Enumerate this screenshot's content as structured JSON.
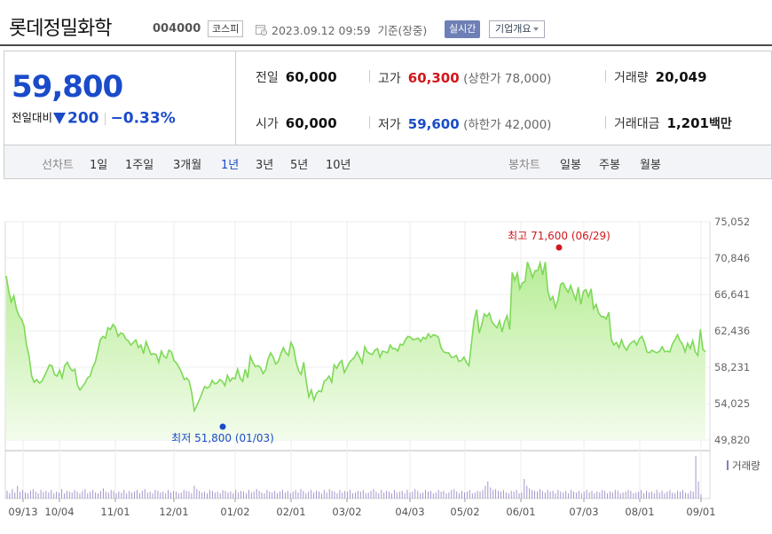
{
  "header": {
    "company_name": "롯데정밀화학",
    "stock_code": "004000",
    "market": "코스피",
    "timestamp": "2023.09.12 09:59",
    "basis": "기준(장중)",
    "realtime_label": "실시간",
    "overview_label": "기업개요"
  },
  "price": {
    "current": "59,800",
    "change_label": "전일대비",
    "change_value": "200",
    "change_percent": "−0.33%"
  },
  "info": {
    "prev_close_label": "전일",
    "prev_close": "60,000",
    "high_label": "고가",
    "high": "60,300",
    "upper_limit": "(상한가 78,000)",
    "volume_label": "거래량",
    "volume": "20,049",
    "open_label": "시가",
    "open": "60,000",
    "low_label": "저가",
    "low": "59,600",
    "lower_limit": "(하한가 42,000)",
    "amount_label": "거래대금",
    "amount": "1,201",
    "amount_unit": "백만"
  },
  "period_bar": {
    "line_label": "선차트",
    "line_options": [
      "1일",
      "1주일",
      "3개월",
      "1년",
      "3년",
      "5년",
      "10년"
    ],
    "line_active": "1년",
    "candle_label": "봉차트",
    "candle_options": [
      "일봉",
      "주봉",
      "월봉"
    ]
  },
  "colors": {
    "up": "#d1171d",
    "down": "#1a4bc9",
    "area_line": "#7ed957",
    "area_fill": "#c9f0b4"
  },
  "chart_data": {
    "type": "area",
    "y_ticks": [
      "75,052",
      "70,846",
      "66,641",
      "62,436",
      "58,231",
      "54,025",
      "49,820"
    ],
    "ylim": [
      49820,
      75052
    ],
    "x_ticks": [
      "09/13",
      "10/04",
      "11/01",
      "12/01",
      "01/02",
      "02/01",
      "03/02",
      "04/03",
      "05/02",
      "06/01",
      "07/03",
      "08/01",
      "09/01"
    ],
    "high_annotation": "최고 71,600 (06/29)",
    "low_annotation": "최저 51,800 (01/03)",
    "volume_legend": "거래량",
    "prices": [
      68800,
      67000,
      65800,
      66500,
      65000,
      64200,
      63800,
      63000,
      60800,
      59500,
      57200,
      56500,
      56800,
      56400,
      56600,
      57200,
      57800,
      58500,
      58400,
      57400,
      57200,
      57900,
      57000,
      58400,
      58800,
      58200,
      57800,
      58000,
      56200,
      55600,
      56000,
      56400,
      57000,
      57200,
      58200,
      58800,
      60100,
      61400,
      61800,
      61600,
      62800,
      62600,
      63200,
      62800,
      61800,
      62200,
      62100,
      61500,
      61300,
      60800,
      61100,
      61400,
      60500,
      60800,
      59800,
      61200,
      60400,
      59700,
      59800,
      59700,
      58800,
      60100,
      59500,
      59300,
      60200,
      60000,
      59000,
      58700,
      58200,
      57600,
      56800,
      57000,
      56600,
      55200,
      53200,
      53800,
      54500,
      55200,
      56000,
      55800,
      56000,
      56700,
      56300,
      56400,
      56800,
      56600,
      56100,
      57300,
      56600,
      57000,
      56900,
      58000,
      57000,
      56600,
      58000,
      57000,
      59500,
      58800,
      58300,
      58400,
      58200,
      57500,
      57900,
      59200,
      59900,
      59400,
      58600,
      58900,
      59800,
      60500,
      59900,
      59600,
      61100,
      60500,
      58800,
      57800,
      57400,
      58800,
      56600,
      54800,
      55600,
      54400,
      55200,
      55500,
      55400,
      56600,
      56800,
      57200,
      56500,
      58500,
      58100,
      58700,
      59000,
      57600,
      58200,
      58800,
      59100,
      59400,
      60000,
      59400,
      58700,
      60600,
      60000,
      59800,
      59700,
      60200,
      60400,
      59400,
      60100,
      60000,
      59900,
      60800,
      60400,
      60400,
      60100,
      60900,
      60800,
      61400,
      61800,
      61700,
      61400,
      61500,
      61600,
      61200,
      61700,
      61500,
      62100,
      61700,
      62000,
      61900,
      61700,
      60500,
      60000,
      59900,
      59900,
      59400,
      59400,
      59600,
      58900,
      59000,
      59400,
      58800,
      58400,
      61100,
      63600,
      64900,
      62200,
      63100,
      64400,
      64100,
      64500,
      63500,
      63100,
      62800,
      63600,
      62300,
      63500,
      64200,
      62600,
      69200,
      68300,
      69100,
      67300,
      68000,
      68100,
      70400,
      69600,
      68600,
      69400,
      69400,
      70300,
      68900,
      70400,
      67100,
      66000,
      66400,
      65100,
      66000,
      67800,
      68000,
      67400,
      66900,
      67700,
      66800,
      66000,
      67500,
      65500,
      67000,
      67200,
      66400,
      67300,
      65000,
      65500,
      64500,
      64100,
      64100,
      63800,
      64600,
      61400,
      60800,
      61100,
      60500,
      61400,
      60600,
      60200,
      60800,
      61100,
      61300,
      60800,
      61500,
      61800,
      61100,
      60000,
      59900,
      60200,
      60000,
      59900,
      60100,
      60600,
      60000,
      60100,
      60000,
      60900,
      61400,
      62000,
      61300,
      60900,
      60000,
      61000,
      60400,
      61300,
      60000,
      59600,
      62600,
      60300,
      60000
    ],
    "volume_peaks": [
      0.18,
      0.12,
      0.22,
      0.14,
      0.3,
      0.16,
      0.2,
      0.14,
      0.12,
      0.18,
      0.22,
      0.16,
      0.12,
      0.2,
      0.15,
      0.18,
      0.14,
      0.2,
      0.12,
      0.16,
      0.14,
      0.22,
      0.12,
      0.18,
      0.16,
      0.14,
      0.2,
      0.16,
      0.12,
      0.18,
      0.22,
      0.12,
      0.16,
      0.2,
      0.14,
      0.12,
      0.18,
      0.24,
      0.16,
      0.14,
      0.2,
      0.18,
      0.12,
      0.16,
      0.14,
      0.2,
      0.12,
      0.18,
      0.14,
      0.16,
      0.2,
      0.12,
      0.18,
      0.22,
      0.14,
      0.16,
      0.12,
      0.2,
      0.18,
      0.14,
      0.16,
      0.12,
      0.2,
      0.14,
      0.18,
      0.16,
      0.12,
      0.14,
      0.2,
      0.18,
      0.16,
      0.12,
      0.3,
      0.22,
      0.18,
      0.14,
      0.16,
      0.12,
      0.2,
      0.18,
      0.14,
      0.16,
      0.12,
      0.2,
      0.18,
      0.14,
      0.16,
      0.12,
      0.2,
      0.14,
      0.18,
      0.16,
      0.12,
      0.2,
      0.14,
      0.16,
      0.22,
      0.18,
      0.14,
      0.12,
      0.2,
      0.16,
      0.14,
      0.18,
      0.12,
      0.16,
      0.2,
      0.14,
      0.18,
      0.12,
      0.16,
      0.2,
      0.14,
      0.22,
      0.18,
      0.12,
      0.16,
      0.2,
      0.14,
      0.18,
      0.16,
      0.12,
      0.2,
      0.14,
      0.22,
      0.18,
      0.16,
      0.12,
      0.2,
      0.14,
      0.18,
      0.16,
      0.2,
      0.12,
      0.14,
      0.18,
      0.16,
      0.2,
      0.12,
      0.14,
      0.18,
      0.22,
      0.16,
      0.12,
      0.2,
      0.14,
      0.18,
      0.16,
      0.12,
      0.2,
      0.14,
      0.16,
      0.18,
      0.12,
      0.2,
      0.14,
      0.16,
      0.22,
      0.18,
      0.12,
      0.14,
      0.2,
      0.16,
      0.18,
      0.12,
      0.14,
      0.2,
      0.16,
      0.18,
      0.12,
      0.14,
      0.2,
      0.22,
      0.16,
      0.12,
      0.18,
      0.14,
      0.16,
      0.2,
      0.12,
      0.14,
      0.18,
      0.16,
      0.2,
      0.3,
      0.4,
      0.26,
      0.2,
      0.22,
      0.18,
      0.16,
      0.2,
      0.14,
      0.12,
      0.18,
      0.16,
      0.2,
      0.12,
      0.14,
      0.46,
      0.3,
      0.24,
      0.2,
      0.18,
      0.16,
      0.22,
      0.18,
      0.14,
      0.2,
      0.16,
      0.18,
      0.12,
      0.2,
      0.16,
      0.14,
      0.18,
      0.12,
      0.2,
      0.16,
      0.14,
      0.18,
      0.12,
      0.16,
      0.2,
      0.14,
      0.18,
      0.12,
      0.16,
      0.14,
      0.2,
      0.18,
      0.12,
      0.16,
      0.14,
      0.2,
      0.18,
      0.12,
      0.14,
      0.16,
      0.2,
      0.18,
      0.12,
      0.14,
      0.16,
      0.2,
      0.12,
      0.18,
      0.14,
      0.16,
      0.12,
      0.2,
      0.14,
      0.18,
      0.12,
      0.16,
      0.2,
      0.14,
      0.12,
      0.18,
      0.16,
      0.2,
      0.14,
      0.12,
      0.18,
      0.16,
      1.0,
      0.4,
      0.1
    ]
  }
}
